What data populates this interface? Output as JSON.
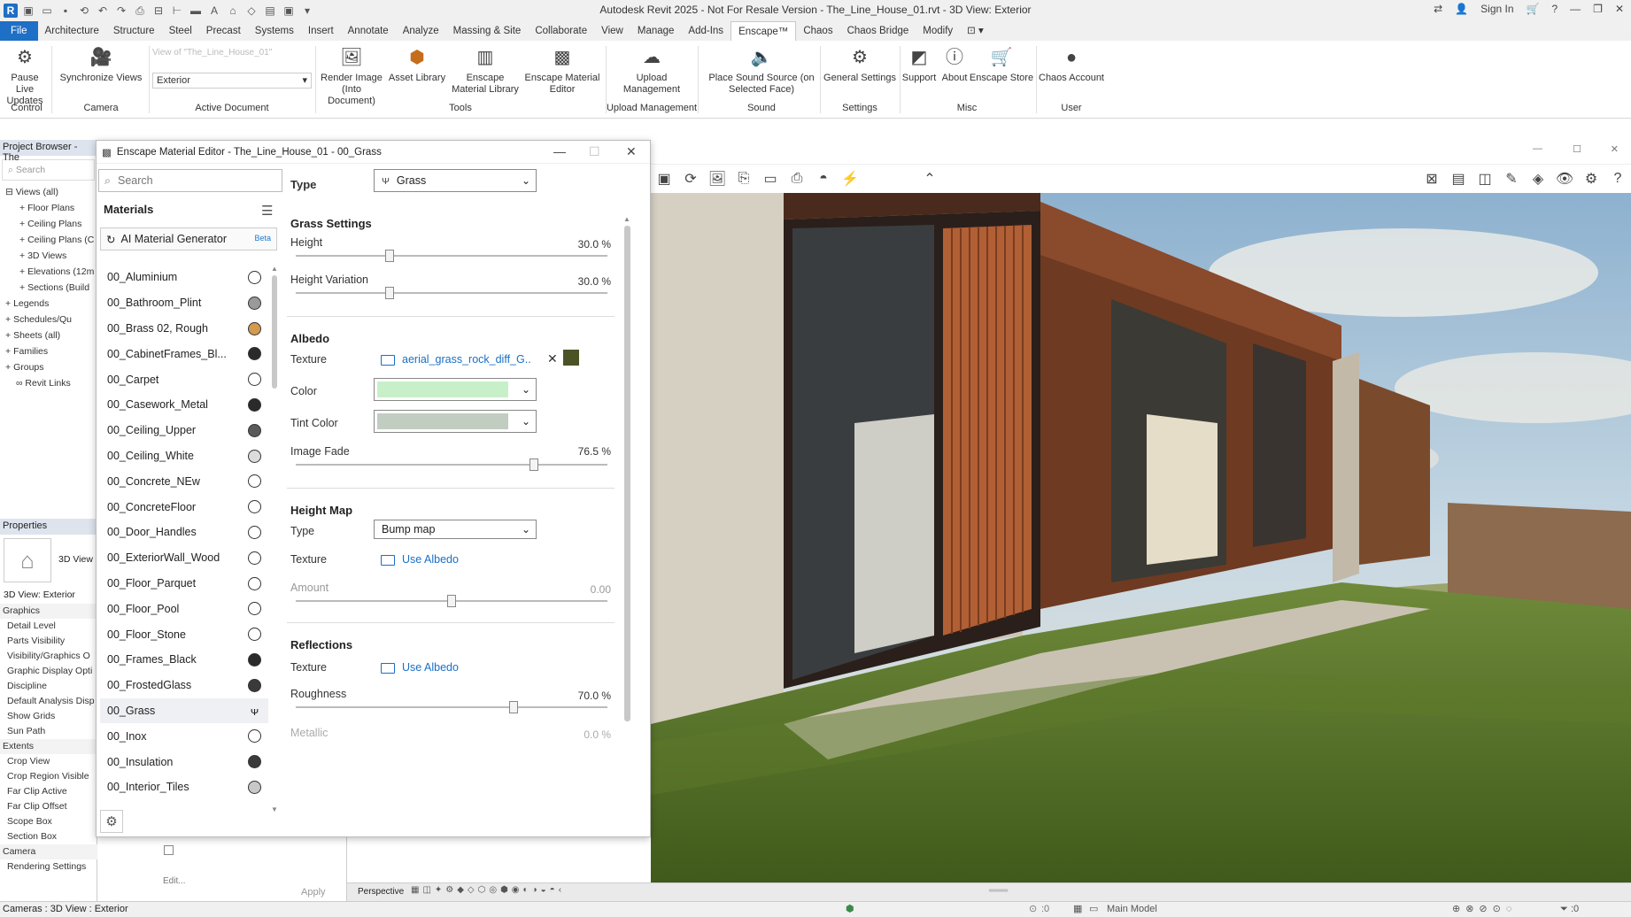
{
  "app": {
    "title": "Autodesk Revit 2025 - Not For Resale Version - The_Line_House_01.rvt - 3D View: Exterior",
    "sign_in": "Sign In"
  },
  "menu_tabs": [
    "File",
    "Architecture",
    "Structure",
    "Steel",
    "Precast",
    "Systems",
    "Insert",
    "Annotate",
    "Analyze",
    "Massing & Site",
    "Collaborate",
    "View",
    "Manage",
    "Add-Ins",
    "Enscape™",
    "Chaos",
    "Chaos Bridge",
    "Modify"
  ],
  "ribbon": {
    "pause_live": "Pause Live Updates",
    "sync_views": "Synchronize Views",
    "active_doc_view": "Exterior",
    "active_doc_hint": "View of \"The_Line_House_01\"",
    "render_image": "Render Image (Into Document)",
    "asset_library": "Asset Library",
    "material_library": "Enscape Material Library",
    "material_editor": "Enscape Material Editor",
    "upload_mgmt": "Upload Management",
    "place_sound": "Place Sound Source (on Selected Face)",
    "general_settings": "General Settings",
    "support": "Support",
    "about": "About",
    "store": "Enscape Store",
    "chaos_account": "Chaos Account",
    "groups": {
      "control": "Control",
      "camera": "Camera",
      "active_document": "Active Document",
      "tools": "Tools",
      "upload_management": "Upload Management",
      "sound": "Sound",
      "settings": "Settings",
      "misc": "Misc",
      "user": "User"
    }
  },
  "project_browser": {
    "title": "Project Browser - The",
    "search_placeholder": "Search",
    "items": [
      "Views (all)",
      "Floor Plans",
      "Ceiling Plans",
      "Ceiling Plans (C",
      "3D Views",
      "Elevations (12m",
      "Sections (Build",
      "Legends",
      "Schedules/Qu",
      "Sheets (all)",
      "Families",
      "Groups",
      "Revit Links"
    ]
  },
  "properties": {
    "title": "Properties",
    "type_label": "3D View",
    "view_name": "3D View: Exterior",
    "rows": [
      "Graphics",
      "Detail Level",
      "Parts Visibility",
      "Visibility/Graphics O",
      "Graphic Display Opti",
      "Discipline",
      "Default Analysis Disp",
      "Show Grids",
      "Sun Path",
      "Extents",
      "Crop View",
      "Crop Region Visible",
      "Far Clip Active",
      "Far Clip Offset",
      "Scope Box",
      "Section Box",
      "Camera",
      "Rendering Settings"
    ],
    "apply": "Apply",
    "edit": "Edit..."
  },
  "editor": {
    "title": "Enscape Material Editor - The_Line_House_01 - 00_Grass",
    "search_placeholder": "Search",
    "materials_heading": "Materials",
    "ai_generator": "AI Material Generator",
    "beta": "Beta",
    "materials": [
      {
        "name": "00_Aluminium",
        "swatch": "#ffffff"
      },
      {
        "name": "00_Bathroom_Plint",
        "swatch": "#9a9a9a"
      },
      {
        "name": "00_Brass 02, Rough",
        "swatch": "#d49a4f"
      },
      {
        "name": "00_CabinetFrames_Bl...",
        "swatch": "#2a2a2a"
      },
      {
        "name": "00_Carpet",
        "swatch": "#ffffff"
      },
      {
        "name": "00_Casework_Metal",
        "swatch": "#2a2a2a"
      },
      {
        "name": "00_Ceiling_Upper",
        "swatch": "#5a5a5a"
      },
      {
        "name": "00_Ceiling_White",
        "swatch": "#dcdcdc"
      },
      {
        "name": "00_Concrete_NEw",
        "swatch": "#ffffff"
      },
      {
        "name": "00_ConcreteFloor",
        "swatch": "#ffffff"
      },
      {
        "name": "00_Door_Handles",
        "swatch": "#ffffff"
      },
      {
        "name": "00_ExteriorWall_Wood",
        "swatch": "#ffffff"
      },
      {
        "name": "00_Floor_Parquet",
        "swatch": "#ffffff"
      },
      {
        "name": "00_Floor_Pool",
        "swatch": "#ffffff"
      },
      {
        "name": "00_Floor_Stone",
        "swatch": "#ffffff"
      },
      {
        "name": "00_Frames_Black",
        "swatch": "#2a2a2a"
      },
      {
        "name": "00_FrostedGlass",
        "swatch": "#3a3a3a"
      },
      {
        "name": "00_Grass",
        "swatch": "grass"
      },
      {
        "name": "00_Inox",
        "swatch": "#ffffff"
      },
      {
        "name": "00_Insulation",
        "swatch": "#3a3a3a"
      },
      {
        "name": "00_Interior_Tiles",
        "swatch": "#c8c8c8"
      }
    ],
    "type_label": "Type",
    "type_value": "Grass",
    "grass_settings": "Grass Settings",
    "height_label": "Height",
    "height_value": "30.0 %",
    "height_pct": 30,
    "height_var_label": "Height Variation",
    "height_var_value": "30.0 %",
    "height_var_pct": 30,
    "albedo": "Albedo",
    "texture_label": "Texture",
    "albedo_texture": "aerial_grass_rock_diff_G...",
    "albedo_texture_color": "#4b5224",
    "color_label": "Color",
    "color_value": "#c8f0c8",
    "tint_label": "Tint Color",
    "tint_value": "#c2cdc2",
    "image_fade_label": "Image Fade",
    "image_fade_value": "76.5 %",
    "image_fade_pct": 76.5,
    "height_map": "Height Map",
    "hm_type_label": "Type",
    "hm_type_value": "Bump map",
    "hm_texture_label": "Texture",
    "hm_texture_value": "Use Albedo",
    "amount_label": "Amount",
    "amount_value": "0.00",
    "amount_pct": 50,
    "reflections": "Reflections",
    "refl_texture_label": "Texture",
    "refl_texture_value": "Use Albedo",
    "roughness_label": "Roughness",
    "roughness_value": "70.0 %",
    "roughness_pct": 70,
    "metallic_label": "Metallic",
    "metallic_value": "0.0 %"
  },
  "bottom": {
    "perspective": "Perspective",
    "status": "Cameras : 3D View : Exterior",
    "main_model": "Main Model",
    "sel_count": ":0",
    "filter_count": ":0"
  }
}
